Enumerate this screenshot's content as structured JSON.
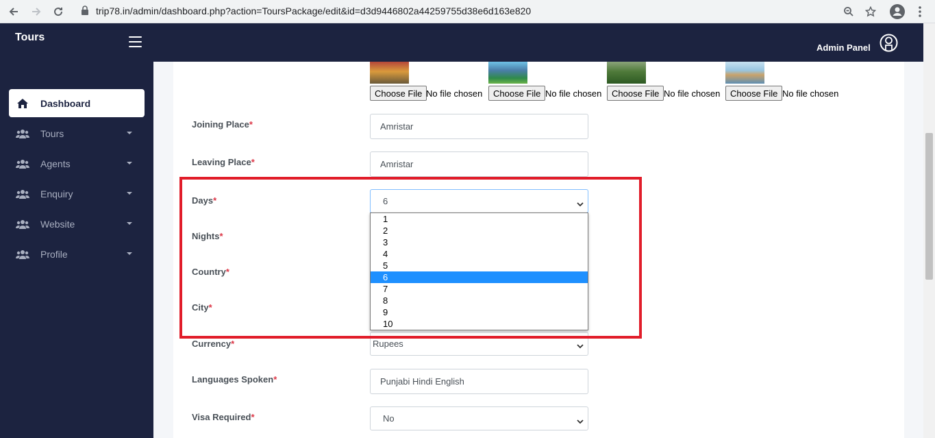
{
  "browser": {
    "url": "trip78.in/admin/dashboard.php?action=ToursPackage/edit&id=d3d9446802a44259755d38e6d163e820"
  },
  "header": {
    "brand": "Tours",
    "admin_label": "Admin Panel"
  },
  "sidebar": {
    "items": [
      {
        "label": "Dashboard",
        "icon": "home-icon"
      },
      {
        "label": "Tours",
        "icon": "users-icon"
      },
      {
        "label": "Agents",
        "icon": "users-icon"
      },
      {
        "label": "Enquiry",
        "icon": "users-icon"
      },
      {
        "label": "Website",
        "icon": "users-icon"
      },
      {
        "label": "Profile",
        "icon": "users-icon"
      }
    ]
  },
  "uploads": [
    {
      "button": "Choose File",
      "status": "No file chosen"
    },
    {
      "button": "Choose File",
      "status": "No file chosen"
    },
    {
      "button": "Choose File",
      "status": "No file chosen"
    },
    {
      "button": "Choose File",
      "status": "No file chosen"
    }
  ],
  "form": {
    "joining_place": {
      "label": "Joining Place",
      "value": "Amristar"
    },
    "leaving_place": {
      "label": "Leaving Place",
      "value": "Amristar"
    },
    "days": {
      "label": "Days",
      "value": "6",
      "options": [
        "1",
        "2",
        "3",
        "4",
        "5",
        "6",
        "7",
        "8",
        "9",
        "10"
      ]
    },
    "nights": {
      "label": "Nights"
    },
    "country": {
      "label": "Country"
    },
    "city": {
      "label": "City"
    },
    "currency": {
      "label": "Currency",
      "value": "Rupees"
    },
    "languages": {
      "label": "Languages Spoken",
      "value": "Punjabi Hindi English"
    },
    "visa": {
      "label": "Visa Required",
      "value": "No"
    },
    "required_mark": "*"
  },
  "colors": {
    "sidebar_bg": "#1c2340",
    "highlight": "#e11d2a",
    "selected_option": "#1e90ff"
  }
}
